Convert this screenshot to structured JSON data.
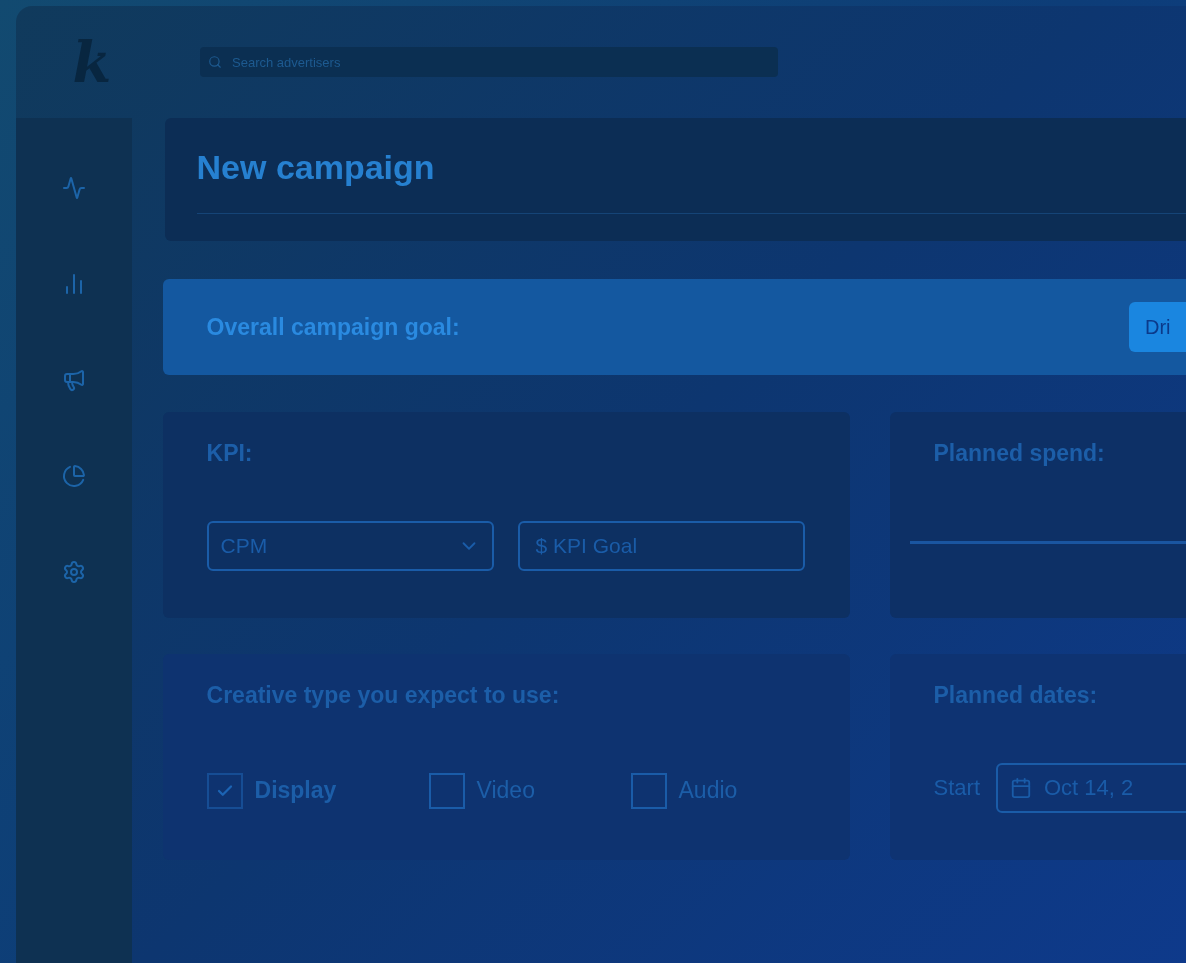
{
  "logo": {
    "text": "k"
  },
  "search": {
    "placeholder": "Search advertisers"
  },
  "sidebar": {
    "items": [
      {
        "kind": "activity",
        "selected": false
      },
      {
        "kind": "chart",
        "selected": false
      },
      {
        "kind": "megaphone",
        "selected": false
      },
      {
        "kind": "pie",
        "selected": false
      },
      {
        "kind": "settings",
        "selected": false
      }
    ]
  },
  "page": {
    "title": "New campaign"
  },
  "goal": {
    "label": "Overall campaign goal:",
    "button": "Dri"
  },
  "kpi": {
    "title": "KPI:",
    "select": {
      "value": "CPM"
    },
    "goal_field": {
      "placeholder": "$ KPI Goal"
    }
  },
  "spend": {
    "title": "Planned spend:"
  },
  "creative": {
    "title": "Creative type you expect to use:",
    "options": [
      {
        "label": "Display",
        "checked": true
      },
      {
        "label": "Video",
        "checked": false
      },
      {
        "label": "Audio",
        "checked": false
      }
    ]
  },
  "dates": {
    "title": "Planned dates:",
    "start_label": "Start",
    "start_value": "Oct 14, 2"
  }
}
